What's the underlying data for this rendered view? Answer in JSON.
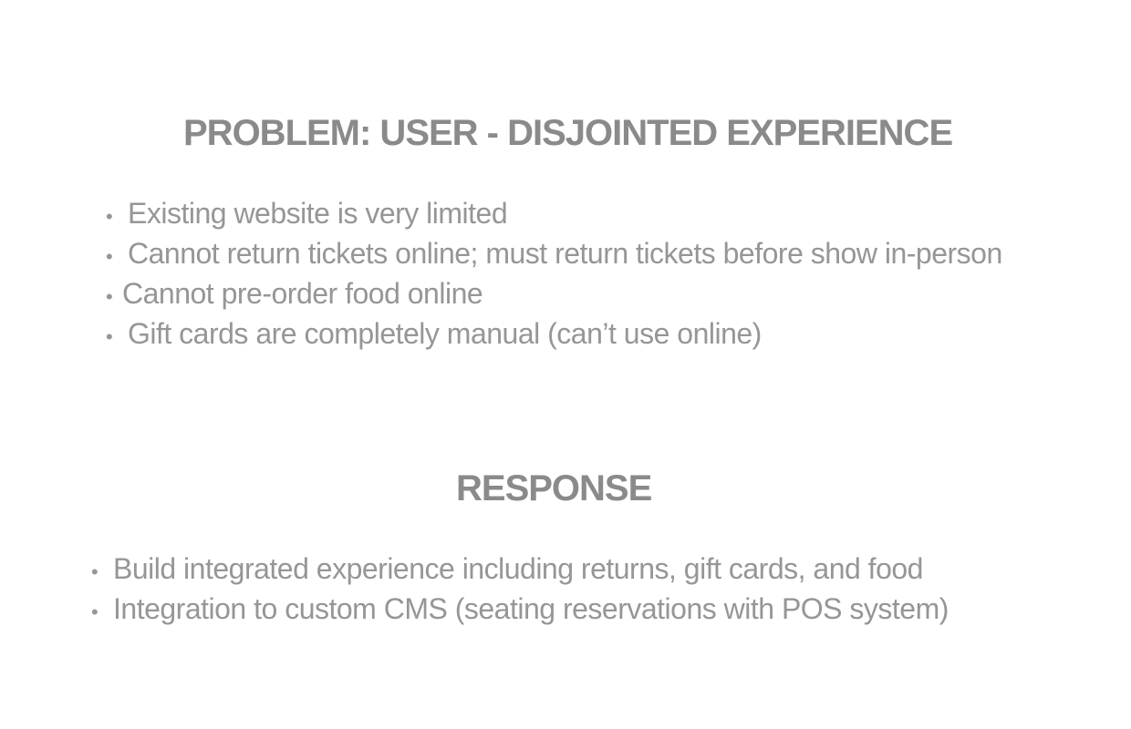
{
  "problem": {
    "title": "PROBLEM: USER - DISJOINTED EXPERIENCE",
    "bullet_glyph": "•",
    "items": [
      "Existing website is very limited",
      "Cannot return tickets online; must return tickets before show in-person",
      "Cannot pre-order food online",
      "Gift cards are completely manual (can’t use online)"
    ]
  },
  "response": {
    "title": "RESPONSE",
    "bullet_glyph": "•",
    "items": [
      "Build integrated experience including returns, gift cards, and food",
      "Integration to custom CMS (seating reservations with POS system)"
    ]
  },
  "colors": {
    "heading": "#8a8a8a",
    "body_text": "#969696",
    "background": "#ffffff"
  }
}
